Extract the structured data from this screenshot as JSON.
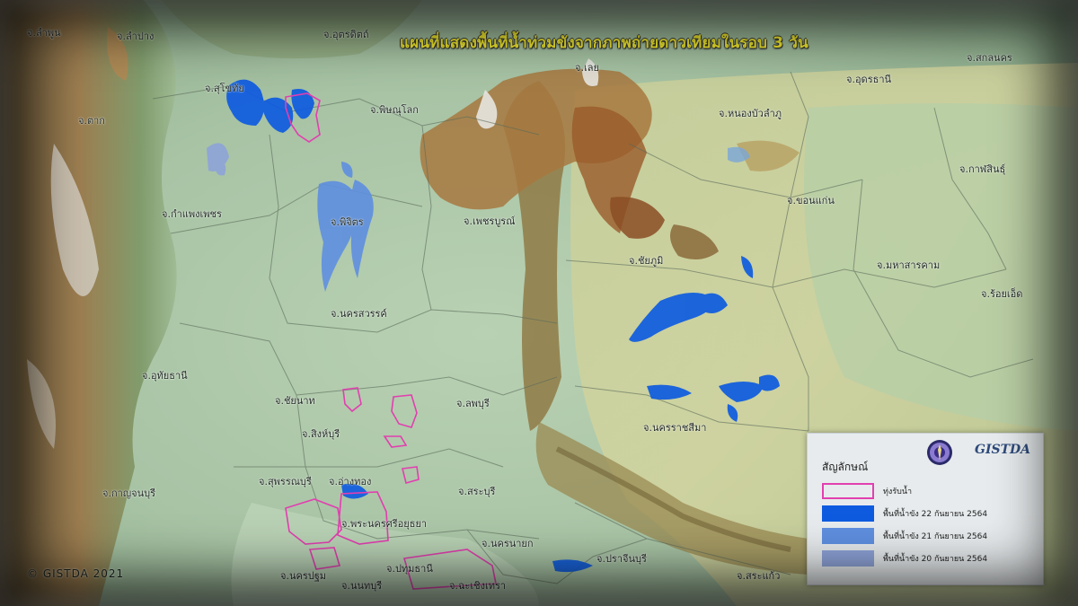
{
  "map": {
    "title": "แผนที่แสดงพื้นที่น้ำท่วมขังจากภาพถ่ายดาวเทียมในรอบ 3 วัน",
    "credit": "© GISTDA 2021",
    "places": [
      "จ.ลำพูน",
      "จ.ลำปาง",
      "จ.อุตรดิตถ์",
      "จ.เลย",
      "จ.อุดรธานี",
      "จ.สกลนคร",
      "จ.สุโขทัย",
      "จ.ตาก",
      "จ.พิษณุโลก",
      "จ.หนองบัวลำภู",
      "จ.กาฬสินธุ์",
      "จ.กำแพงเพชร",
      "จ.พิจิตร",
      "จ.เพชรบูรณ์",
      "จ.ขอนแก่น",
      "จ.ชัยภูมิ",
      "จ.มหาสารคาม",
      "จ.ร้อยเอ็ด",
      "จ.นครสวรรค์",
      "จ.อุทัยธานี",
      "จ.ชัยนาท",
      "จ.ลพบุรี",
      "จ.สิงห์บุรี",
      "จ.นครราชสีมา",
      "จ.สุพรรณบุรี",
      "จ.อ่างทอง",
      "จ.กาญจนบุรี",
      "จ.สระบุรี",
      "จ.พระนครศรีอยุธยา",
      "จ.นครนายก",
      "จ.ปราจีนบุรี",
      "จ.นครปฐม",
      "จ.ปทุมธานี",
      "จ.นนทบุรี",
      "จ.ฉะเชิงเทรา",
      "จ.สระแก้ว"
    ]
  },
  "legend": {
    "title": "สัญลักษณ์",
    "logo_text": "GISTDA",
    "items": [
      {
        "label": "ทุ่งรับน้ำ",
        "kind": "outline",
        "color": "#e23fb0"
      },
      {
        "label": "พื้นที่น้ำขัง 22 กันยายน 2564",
        "kind": "fill",
        "color": "#0e5be0"
      },
      {
        "label": "พื้นที่น้ำขัง 21 กันยายน 2564",
        "kind": "fill",
        "color": "#5f8fe0"
      },
      {
        "label": "พื้นที่น้ำขัง 20 กันยายน 2564",
        "kind": "fill",
        "color": "#8ea3d8"
      }
    ]
  },
  "colors": {
    "title_text": "#f2ea2e",
    "lowland": "#a9c4a6",
    "flood_22": "#0e5be0",
    "flood_21": "#5f8fe0",
    "flood_20": "#8ea3d8",
    "retention_area": "#e23fb0"
  }
}
